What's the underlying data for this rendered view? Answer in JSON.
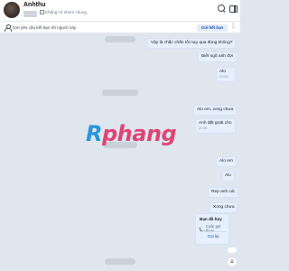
{
  "header": {
    "name": "Anhthu",
    "group_label": "Không có nhóm chung",
    "icons": [
      "search-icon",
      "sidebar-panel-icon"
    ]
  },
  "friend_bar": {
    "text": "Gửi yêu cầu kết bạn tới người này",
    "button_label": "Gửi kết bạn",
    "more_label": "⋮"
  },
  "messages": [
    {
      "text": "Vậy là chắc chắn tối nay qua đúng không?",
      "time": ""
    },
    {
      "text": "Biết ngõ anh đợi",
      "time": ""
    },
    {
      "text": "Alo",
      "time": "21:05"
    },
    {
      "text": "Alo em, xong chưa",
      "time": ""
    },
    {
      "text": "Anh đặt grab cho",
      "time": "21:30"
    },
    {
      "text": "Alo em",
      "time": ""
    },
    {
      "text": "Alo",
      "time": ""
    },
    {
      "text": "Rep anh cái",
      "time": ""
    },
    {
      "text": "Xong chưa",
      "time": ""
    }
  ],
  "call_card": {
    "title": "Bạn đã hủy",
    "subtitle": "Cuộc gọi thoại",
    "action": "Gọi lại",
    "icon": "phone-icon"
  },
  "scroll_button_icon": "chevron-double-down-icon",
  "watermark": {
    "part1": "R",
    "part2": "phang"
  },
  "colors": {
    "chat_bg": "#dfe6ee",
    "bubble_bg": "#e5efff",
    "accent": "#1d4fb8"
  }
}
